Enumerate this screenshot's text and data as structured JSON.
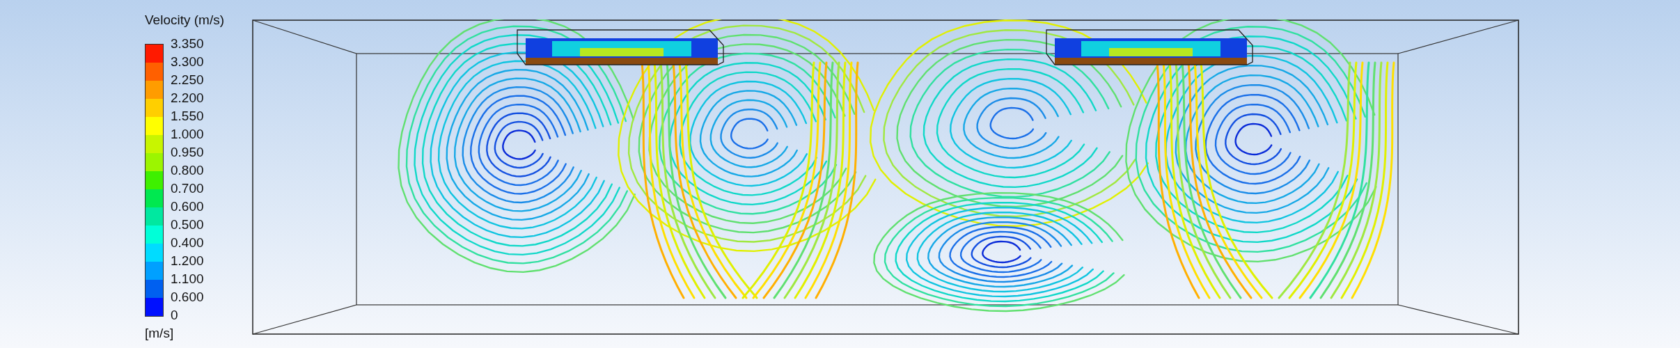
{
  "legend": {
    "title": "Velocity (m/s)",
    "ticks": [
      "3.350",
      "3.300",
      "2.250",
      "2.200",
      "1.550",
      "1.000",
      "0.950",
      "0.800",
      "0.700",
      "0.600",
      "0.500",
      "0.400",
      "1.200",
      "1.100",
      "0.600",
      "0"
    ],
    "bands": [
      {
        "color": "#ff1a00"
      },
      {
        "color": "#ff6000"
      },
      {
        "color": "#ff9c00"
      },
      {
        "color": "#ffcf00"
      },
      {
        "color": "#ffff00"
      },
      {
        "color": "#c8f500"
      },
      {
        "color": "#9cf500"
      },
      {
        "color": "#3ef000"
      },
      {
        "color": "#00e850"
      },
      {
        "color": "#00e8a0"
      },
      {
        "color": "#00ffd8"
      },
      {
        "color": "#00dcff"
      },
      {
        "color": "#00a0ff"
      },
      {
        "color": "#0060f0"
      },
      {
        "color": "#0010ff"
      }
    ],
    "unit": "[m/s]"
  }
}
